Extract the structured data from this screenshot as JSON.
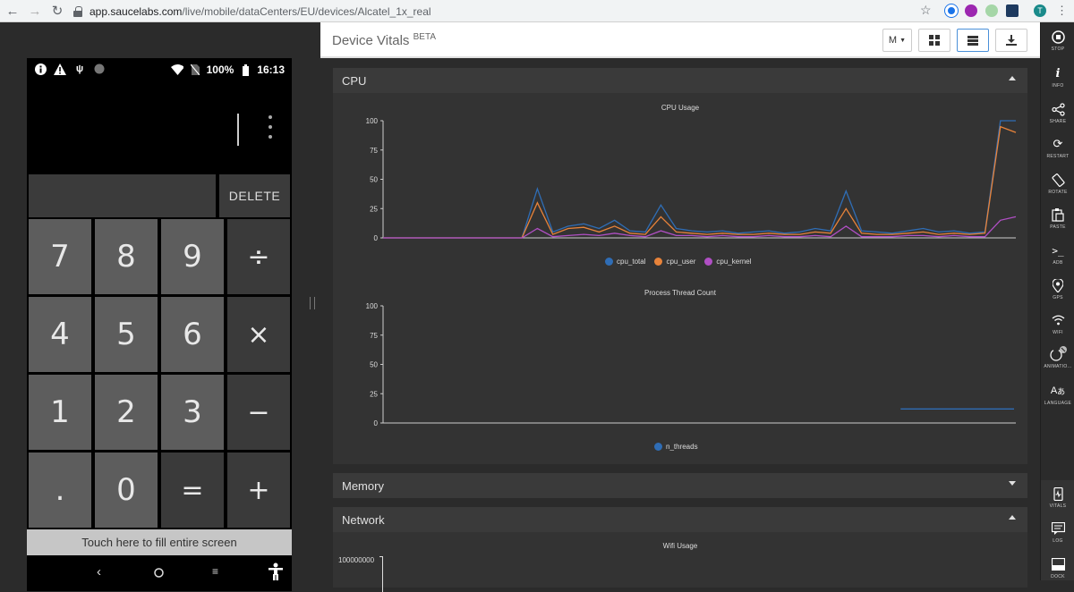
{
  "browser": {
    "url_domain": "app.saucelabs.com",
    "url_path": "/live/mobile/dataCenters/EU/devices/Alcatel_1x_real",
    "profile_initial": "T"
  },
  "phone": {
    "battery": "100%",
    "time": "16:13",
    "delete_label": "DELETE",
    "keys": [
      "7",
      "8",
      "9",
      "÷",
      "4",
      "5",
      "6",
      "×",
      "1",
      "2",
      "3",
      "−",
      ".",
      "0",
      "=",
      "+"
    ],
    "fill_screen_label": "Touch here to fill entire screen"
  },
  "header": {
    "title": "Device Vitals",
    "title_sup": "BETA",
    "dropdown_value": "M"
  },
  "sections": {
    "cpu": "CPU",
    "memory": "Memory",
    "network": "Network"
  },
  "charts": {
    "cpu_title": "CPU Usage",
    "threads_title": "Process Thread Count",
    "wifi_title": "Wifi Usage",
    "wifi_ytick": "100000000",
    "legend_cpu": [
      "cpu_total",
      "cpu_user",
      "cpu_kernel"
    ],
    "legend_threads": [
      "n_threads"
    ],
    "colors": {
      "cpu_total": "#2f6db5",
      "cpu_user": "#e8833a",
      "cpu_kernel": "#b04fc4",
      "n_threads": "#2f6db5"
    }
  },
  "chart_data": [
    {
      "type": "line",
      "title": "CPU Usage",
      "ylim": [
        0,
        100
      ],
      "yticks": [
        "0",
        "25",
        "50",
        "75",
        "100"
      ],
      "series": [
        {
          "name": "cpu_total",
          "values": [
            0,
            0,
            0,
            0,
            0,
            0,
            0,
            0,
            0,
            0,
            42,
            5,
            10,
            12,
            8,
            15,
            6,
            5,
            28,
            8,
            6,
            5,
            6,
            4,
            5,
            6,
            4,
            5,
            8,
            6,
            40,
            6,
            5,
            4,
            6,
            8,
            5,
            6,
            4,
            5,
            100,
            100
          ]
        },
        {
          "name": "cpu_user",
          "values": [
            0,
            0,
            0,
            0,
            0,
            0,
            0,
            0,
            0,
            0,
            30,
            3,
            8,
            9,
            5,
            10,
            4,
            3,
            18,
            5,
            4,
            3,
            4,
            3,
            3,
            4,
            3,
            3,
            5,
            4,
            25,
            4,
            3,
            3,
            4,
            5,
            3,
            4,
            3,
            4,
            95,
            90
          ]
        },
        {
          "name": "cpu_kernel",
          "values": [
            0,
            0,
            0,
            0,
            0,
            0,
            0,
            0,
            0,
            0,
            8,
            1,
            2,
            3,
            2,
            4,
            2,
            1,
            6,
            2,
            2,
            1,
            2,
            1,
            1,
            2,
            1,
            1,
            2,
            1,
            10,
            1,
            1,
            1,
            2,
            2,
            1,
            2,
            1,
            1,
            15,
            18
          ]
        }
      ]
    },
    {
      "type": "line",
      "title": "Process Thread Count",
      "ylim": [
        0,
        100
      ],
      "yticks": [
        "0",
        "25",
        "50",
        "75",
        "100"
      ],
      "series": [
        {
          "name": "n_threads",
          "values": [
            12,
            12
          ]
        }
      ]
    }
  ],
  "toolbar": {
    "stop": "STOP",
    "info": "INFO",
    "share": "SHARE",
    "restart": "RESTART",
    "rotate": "ROTATE",
    "paste": "PASTE",
    "adb": "ADB",
    "gps": "GPS",
    "wifi": "WIFI",
    "animations": "ANIMATIO...",
    "language": "LANGUAGE",
    "vitals": "VITALS",
    "log": "LOG",
    "dock": "DOCK"
  }
}
